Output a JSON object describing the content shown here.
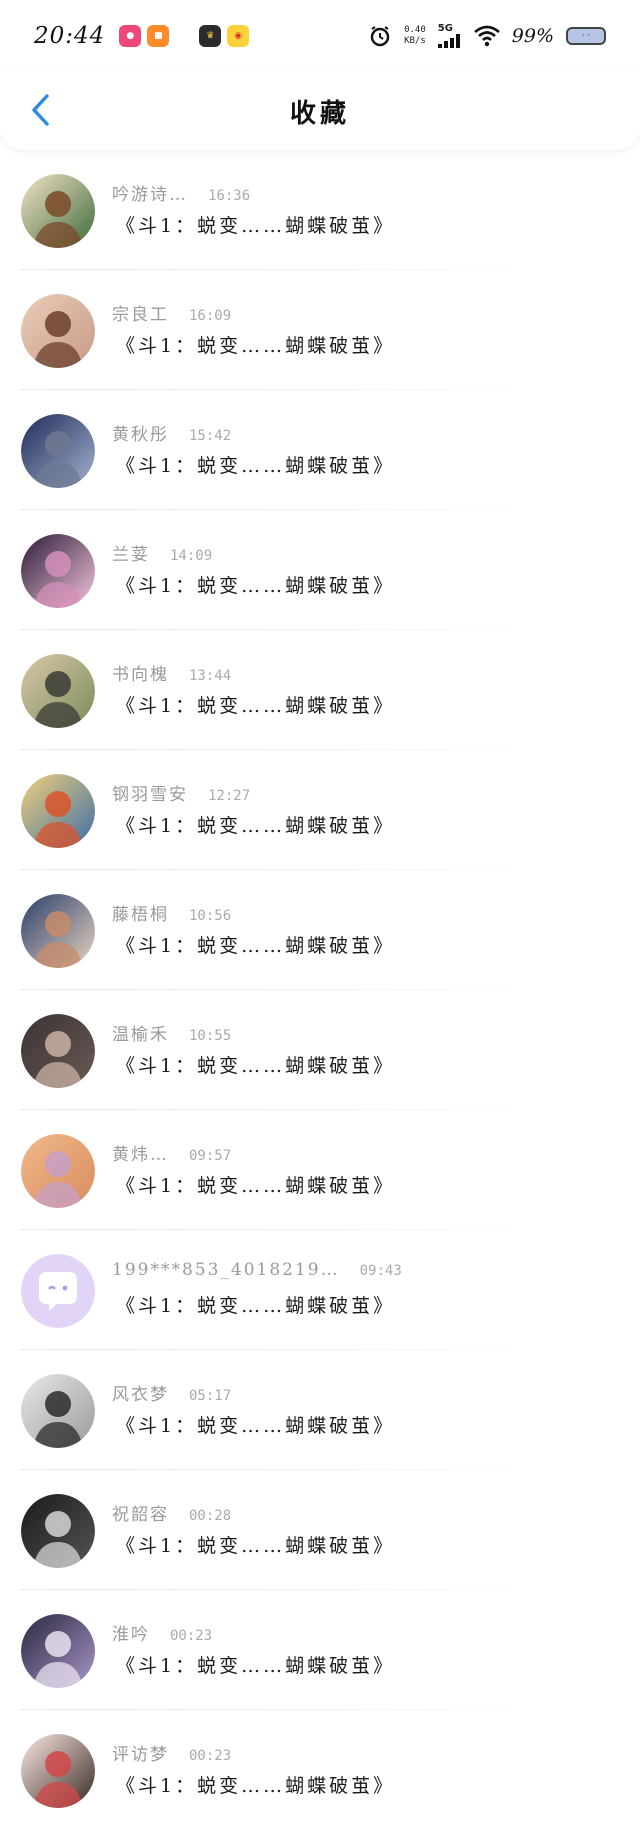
{
  "status_bar": {
    "time": "20:44",
    "net_speed_value": "0.40",
    "net_speed_unit": "KB/s",
    "network": "5G",
    "battery": "99%"
  },
  "header": {
    "title": "收藏"
  },
  "items": [
    {
      "name": "吟游诗…",
      "time": "16:36",
      "message": "《斗1：蜕变……蝴蝶破茧》",
      "avatar_colors": [
        "#f3e2c8",
        "#7a4a2a",
        "#3e6b3a"
      ]
    },
    {
      "name": "宗良工",
      "time": "16:09",
      "message": "《斗1：蜕变……蝴蝶破茧》",
      "avatar_colors": [
        "#e9cdb9",
        "#6b3f2c",
        "#c79a86"
      ]
    },
    {
      "name": "黄秋彤",
      "time": "15:42",
      "message": "《斗1：蜕变……蝴蝶破茧》",
      "avatar_colors": [
        "#1f2c5a",
        "#6d7991",
        "#a4b2cf"
      ]
    },
    {
      "name": "兰荽",
      "time": "14:09",
      "message": "《斗1：蜕变……蝴蝶破茧》",
      "avatar_colors": [
        "#2a1b38",
        "#d48fb8",
        "#f5c6dc"
      ]
    },
    {
      "name": "书向槐",
      "time": "13:44",
      "message": "《斗1：蜕变……蝴蝶破茧》",
      "avatar_colors": [
        "#d9c7a8",
        "#3b3b36",
        "#7b8c5a"
      ]
    },
    {
      "name": "钢羽雪安",
      "time": "12:27",
      "message": "《斗1：蜕变……蝴蝶破茧》",
      "avatar_colors": [
        "#f2cf7a",
        "#d9532b",
        "#3d6fa8"
      ]
    },
    {
      "name": "藤梧桐",
      "time": "10:56",
      "message": "《斗1：蜕变……蝴蝶破茧》",
      "avatar_colors": [
        "#2a3f6a",
        "#c58b6a",
        "#e6d3c0"
      ]
    },
    {
      "name": "温榆禾",
      "time": "10:55",
      "message": "《斗1：蜕变……蝴蝶破茧》",
      "avatar_colors": [
        "#3a3333",
        "#c9b1a5",
        "#6b5a55"
      ]
    },
    {
      "name": "黄炜…",
      "time": "09:57",
      "message": "《斗1：蜕变……蝴蝶破茧》",
      "avatar_colors": [
        "#f0b98a",
        "#c7a0c8",
        "#d98c5f"
      ]
    },
    {
      "name": "199***853_4018219…",
      "time": "09:43",
      "message": "《斗1：蜕变……蝴蝶破茧》",
      "avatar_colors": [
        "#e2d4f6",
        "#ffffff",
        "#b49be0"
      ]
    },
    {
      "name": "风衣梦",
      "time": "05:17",
      "message": "《斗1：蜕变……蝴蝶破茧》",
      "avatar_colors": [
        "#e8e8e8",
        "#2b2b2b",
        "#9a9a9a"
      ]
    },
    {
      "name": "祝韶容",
      "time": "00:28",
      "message": "《斗1：蜕变……蝴蝶破茧》",
      "avatar_colors": [
        "#1a1a1a",
        "#d6d6d6",
        "#555555"
      ]
    },
    {
      "name": "淮吟",
      "time": "00:23",
      "message": "《斗1：蜕变……蝴蝶破茧》",
      "avatar_colors": [
        "#2b2740",
        "#e9e2f0",
        "#a896c8"
      ]
    },
    {
      "name": "评访梦",
      "time": "00:23",
      "message": "《斗1：蜕变……蝴蝶破茧》",
      "avatar_colors": [
        "#fbe9e4",
        "#d2484a",
        "#3a2a24"
      ]
    }
  ]
}
